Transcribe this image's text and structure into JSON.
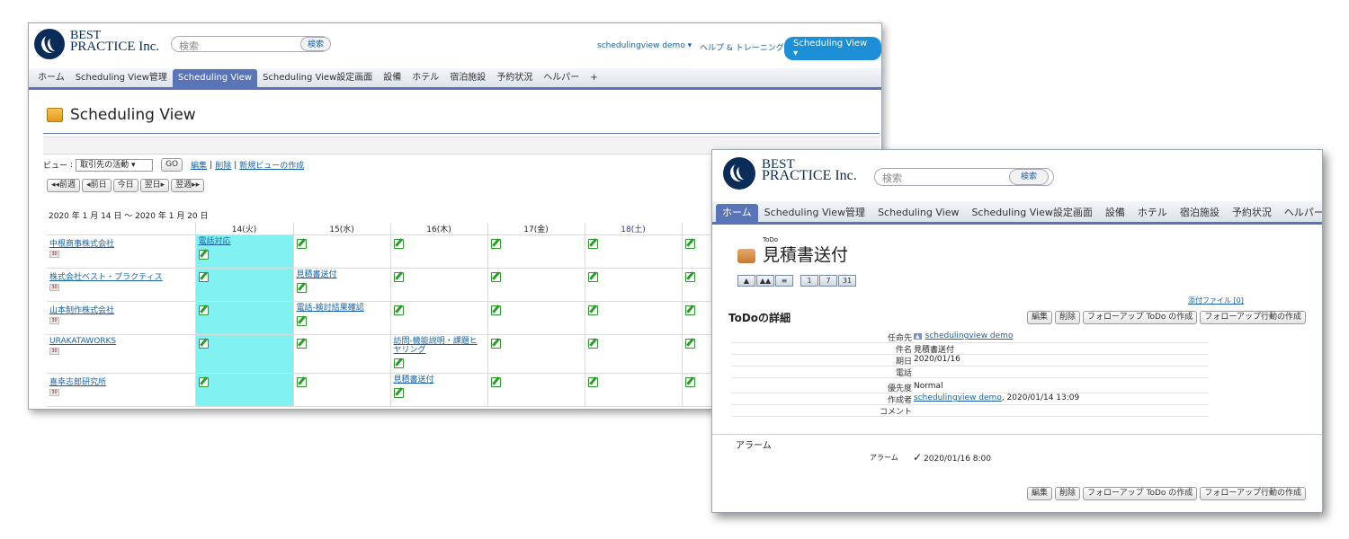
{
  "colors": {
    "navy": "#0b2c57",
    "tab_active": "#5a74b8",
    "highlight_cyan": "#82f1f1",
    "accent_blue": "#1c8fd6",
    "pen_green": "#2e9a2e"
  },
  "back_window": {
    "logo": {
      "line1": "BEST",
      "line2": "PRACTICE Inc."
    },
    "search": {
      "placeholder": "検索",
      "button": "検索"
    },
    "header_links": {
      "user": "schedulingview demo ▾",
      "help": "ヘルプ & トレーニング",
      "app": "Scheduling View ▾"
    },
    "tabs": [
      "ホーム",
      "Scheduling View管理",
      "Scheduling View",
      "Scheduling View設定画面",
      "設備",
      "ホテル",
      "宿泊施設",
      "予約状況",
      "ヘルパー",
      "+"
    ],
    "page_title": "Scheduling View",
    "view_label": "ビュー",
    "view_select": "取引先の活動",
    "go_button": "GO",
    "view_links": {
      "edit": "編集",
      "delete": "削除",
      "new": "新規ビューの作成"
    },
    "nav_buttons": [
      "◂◂前週",
      "◂前日",
      "今日",
      "翌日▸",
      "翌週▸▸"
    ],
    "date_range": "2020 年 1 月 14 日 ～ 2020 年 1 月 20 日",
    "columns": [
      "14(火)",
      "15(水)",
      "16(木)",
      "17(金)",
      "18(土)"
    ],
    "calendar_badge": "30",
    "rows": [
      {
        "account": "中根商事株式会社",
        "cells": [
          "電話対応",
          "",
          "",
          "",
          ""
        ]
      },
      {
        "account": "株式会社ベスト・プラクティス",
        "cells": [
          "",
          "見積書送付",
          "",
          "",
          ""
        ]
      },
      {
        "account": "山本制作株式会社",
        "cells": [
          "",
          "電話-検討結果確認",
          "",
          "",
          ""
        ]
      },
      {
        "account": "URAKATAWORKS",
        "cells": [
          "",
          "",
          "訪問-機能説明・課題ヒヤリング",
          "",
          ""
        ]
      },
      {
        "account": "喜幸志郎研究所",
        "cells": [
          "",
          "",
          "見積書送付",
          "",
          ""
        ]
      }
    ]
  },
  "front_window": {
    "logo": {
      "line1": "BEST",
      "line2": "PRACTICE Inc."
    },
    "search": {
      "placeholder": "検索",
      "button": "検索"
    },
    "tabs": [
      "ホーム",
      "Scheduling View管理",
      "Scheduling View",
      "Scheduling View設定画面",
      "設備",
      "ホテル",
      "宿泊施設",
      "予約状況",
      "ヘルパー"
    ],
    "record_type": "ToDo",
    "record_title": "見積書送付",
    "icon_buttons": [
      "1",
      "7",
      "31"
    ],
    "attachment_link": "添付ファイル [0]",
    "section_title": "ToDoの詳細",
    "actions": {
      "edit": "編集",
      "delete": "削除",
      "followup_todo": "フォローアップ ToDo の作成",
      "followup_event": "フォローアップ行動の作成"
    },
    "fields": [
      {
        "label": "任命先",
        "value": "schedulingview demo",
        "link": true
      },
      {
        "label": "件名",
        "value": "見積書送付",
        "link": false
      },
      {
        "label": "期日",
        "value": "2020/01/16",
        "link": false
      },
      {
        "label": "電話",
        "value": "",
        "link": false
      },
      {
        "label": "優先度",
        "value": "Normal",
        "link": false
      },
      {
        "label": "作成者",
        "value": "schedulingview demo",
        "suffix": ", 2020/01/14 13:09",
        "link": true
      },
      {
        "label": "コメント",
        "value": "",
        "link": false
      }
    ],
    "alarm_section": "アラーム",
    "alarm_label": "アラーム",
    "alarm_check": "✓",
    "alarm_value": "2020/01/16 8:00"
  }
}
